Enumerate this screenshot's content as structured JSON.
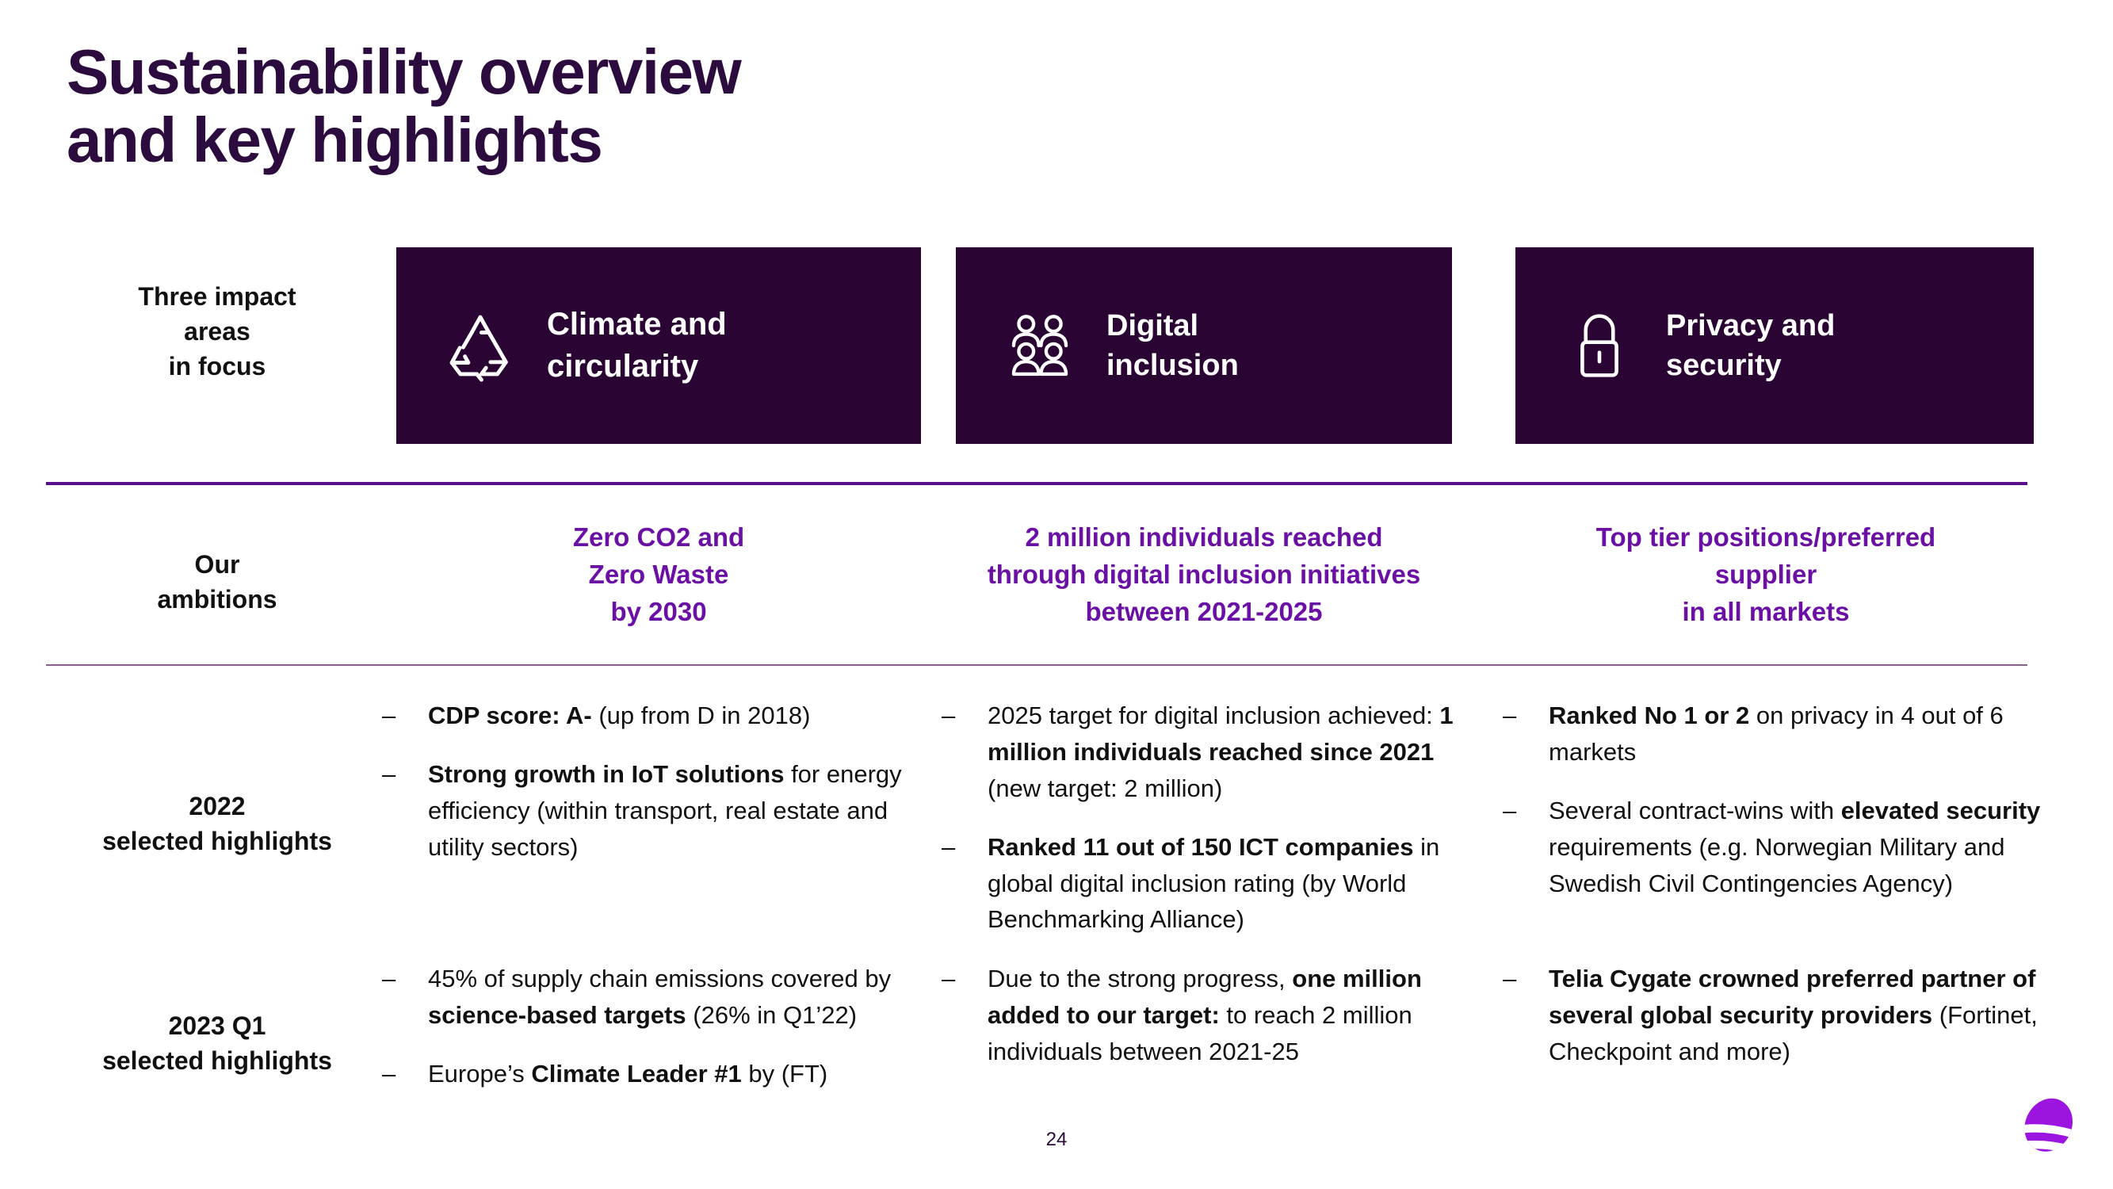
{
  "slide": {
    "title": "Sustainability overview\nand key highlights",
    "page_number": "24",
    "logo_name": "telia-logo"
  },
  "colors": {
    "dark_purple": "#2A0533",
    "brand_purple": "#6B10A5",
    "title_purple": "#2C0B3E",
    "divider_thick": "#5B0F8B",
    "divider_thin": "#5B2B63",
    "text_black": "#111111",
    "card_text": "#FFFFFF"
  },
  "rows": {
    "impact": {
      "label": "Three impact\nareas\nin focus",
      "cards": [
        {
          "icon": "recycle-icon",
          "title": "Climate and\ncircularity"
        },
        {
          "icon": "people-group-icon",
          "title": "Digital\ninclusion"
        },
        {
          "icon": "lock-icon",
          "title": "Privacy and\nsecurity"
        }
      ]
    },
    "ambitions": {
      "label": "Our\nambitions",
      "items": [
        "Zero CO2 and\nZero Waste\nby 2030",
        "2 million individuals reached\nthrough digital inclusion initiatives\nbetween 2021-2025",
        "Top tier positions/preferred\nsupplier\nin all markets"
      ]
    },
    "highlights_2022": {
      "label": "2022\nselected highlights",
      "dash": "–",
      "columns": [
        {
          "bullets": [
            "<b>CDP score: A-</b> (up from D in 2018)",
            "<b>Strong growth in IoT solutions</b> for energy efficiency (within transport, real estate and utility sectors)"
          ]
        },
        {
          "bullets": [
            "2025 target for digital inclusion achieved: <b>1 million individuals reached since 2021</b> (new target: 2 million)",
            "<b>Ranked 11 out of 150 ICT companies</b> in global digital inclusion rating (by World Benchmarking Alliance)"
          ]
        },
        {
          "bullets": [
            "<b>Ranked No 1 or 2</b> on privacy in 4 out of 6 markets",
            "Several contract-wins with <b>elevated security</b> requirements (e.g. Norwegian Military and Swedish Civil Contingencies Agency)"
          ]
        }
      ]
    },
    "highlights_2023": {
      "label": "2023 Q1\nselected highlights",
      "dash": "–",
      "columns": [
        {
          "bullets": [
            "45% of supply chain emissions covered by <b>science-based targets</b> (26% in Q1’22)",
            "Europe’s <b>Climate Leader #1</b> by (FT)"
          ]
        },
        {
          "bullets": [
            "Due to the strong progress, <b>one million added to our target:</b> to reach 2 million individuals between 2021-25"
          ]
        },
        {
          "bullets": [
            "<b>Telia Cygate crowned preferred partner of several global security providers</b> (Fortinet, Checkpoint and more)"
          ]
        }
      ]
    }
  }
}
